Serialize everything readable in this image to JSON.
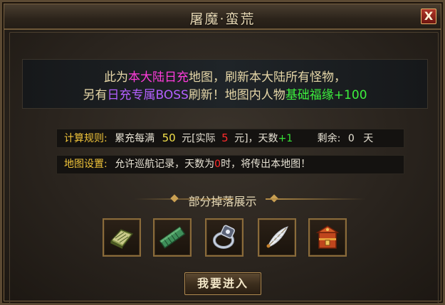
{
  "window": {
    "title": "屠魔·蛮荒",
    "close_label": "X"
  },
  "banner": {
    "line1": {
      "a": "此为",
      "b": "本大陆日充",
      "c": "地图，刷新本大陆所有怪物，"
    },
    "line2": {
      "a": "另有",
      "b": "日充专属BOSS",
      "c": "刷新！地图内人物",
      "d": "基础福缘+100"
    }
  },
  "rule": {
    "label": "计算规则:",
    "text1": "累充每满",
    "amount": "50",
    "text2": "元[实际",
    "actual": "5",
    "text3": "元]，天数",
    "days_bonus": "+1",
    "remain_label": "剩余:",
    "remain_value": "0",
    "remain_unit": "天"
  },
  "setting": {
    "label": "地图设置:",
    "text1": "允许巡航记录，天数为",
    "zero": "0",
    "text2": "时，将传出本地图！"
  },
  "drops": {
    "title": "部分掉落展示",
    "items": [
      {
        "icon": "book-icon"
      },
      {
        "icon": "jade-scroll-icon"
      },
      {
        "icon": "ring-icon"
      },
      {
        "icon": "feather-icon"
      },
      {
        "icon": "treasure-box-icon"
      }
    ]
  },
  "enter_button": "我要进入"
}
